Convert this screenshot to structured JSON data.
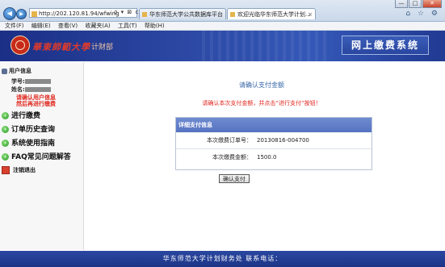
{
  "browser": {
    "address": "http://202.120.81.94/wfwing",
    "address_tools": "ρ ▾ ⊠ c ×",
    "tabs": [
      {
        "title": "华东师范大学公共数据库平台"
      },
      {
        "title": "欢迎光临华东师范大学计划..."
      }
    ],
    "window_controls": [
      "—",
      "□",
      "✕"
    ],
    "right_icons": "⌂ ☆ ⚙"
  },
  "menu": [
    "文件(F)",
    "编辑(E)",
    "查看(V)",
    "收藏夹(A)",
    "工具(T)",
    "帮助(H)"
  ],
  "banner": {
    "school": "華東師範大學",
    "dept": "计财部",
    "system_title": "网上缴费系统"
  },
  "sidebar": {
    "user_header": "用户信息",
    "student_id_label": "学号:",
    "name_label": "姓名:",
    "warning_line1": "请确认用户信息",
    "warning_line2": "然后再进行缴费",
    "nav": [
      {
        "label": "进行缴费"
      },
      {
        "label": "订单历史查询"
      },
      {
        "label": "系统使用指南"
      },
      {
        "label": "FAQ常见问题解答"
      }
    ],
    "logout": "注销退出"
  },
  "content": {
    "title": "请确认支付金额",
    "notice": "请确认本次支付金额，并点击“进行支付”按钮！",
    "detail_header": "详细支付信息",
    "order_label": "本次缴费订单号：",
    "order_value": "20130816-004700",
    "amount_label": "本次缴费金额：",
    "amount_value": "1500.0",
    "confirm_button": "确认支付"
  },
  "footer": {
    "text": "华东师范大学计划财务处 联系电话："
  }
}
